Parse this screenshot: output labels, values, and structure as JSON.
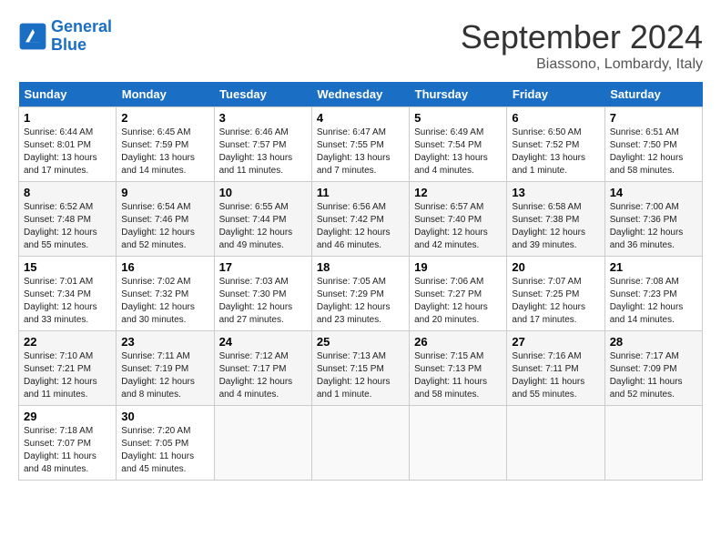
{
  "header": {
    "logo_line1": "General",
    "logo_line2": "Blue",
    "month": "September 2024",
    "location": "Biassono, Lombardy, Italy"
  },
  "weekdays": [
    "Sunday",
    "Monday",
    "Tuesday",
    "Wednesday",
    "Thursday",
    "Friday",
    "Saturday"
  ],
  "weeks": [
    [
      {
        "day": 1,
        "info": "Sunrise: 6:44 AM\nSunset: 8:01 PM\nDaylight: 13 hours\nand 17 minutes."
      },
      {
        "day": 2,
        "info": "Sunrise: 6:45 AM\nSunset: 7:59 PM\nDaylight: 13 hours\nand 14 minutes."
      },
      {
        "day": 3,
        "info": "Sunrise: 6:46 AM\nSunset: 7:57 PM\nDaylight: 13 hours\nand 11 minutes."
      },
      {
        "day": 4,
        "info": "Sunrise: 6:47 AM\nSunset: 7:55 PM\nDaylight: 13 hours\nand 7 minutes."
      },
      {
        "day": 5,
        "info": "Sunrise: 6:49 AM\nSunset: 7:54 PM\nDaylight: 13 hours\nand 4 minutes."
      },
      {
        "day": 6,
        "info": "Sunrise: 6:50 AM\nSunset: 7:52 PM\nDaylight: 13 hours\nand 1 minute."
      },
      {
        "day": 7,
        "info": "Sunrise: 6:51 AM\nSunset: 7:50 PM\nDaylight: 12 hours\nand 58 minutes."
      }
    ],
    [
      {
        "day": 8,
        "info": "Sunrise: 6:52 AM\nSunset: 7:48 PM\nDaylight: 12 hours\nand 55 minutes."
      },
      {
        "day": 9,
        "info": "Sunrise: 6:54 AM\nSunset: 7:46 PM\nDaylight: 12 hours\nand 52 minutes."
      },
      {
        "day": 10,
        "info": "Sunrise: 6:55 AM\nSunset: 7:44 PM\nDaylight: 12 hours\nand 49 minutes."
      },
      {
        "day": 11,
        "info": "Sunrise: 6:56 AM\nSunset: 7:42 PM\nDaylight: 12 hours\nand 46 minutes."
      },
      {
        "day": 12,
        "info": "Sunrise: 6:57 AM\nSunset: 7:40 PM\nDaylight: 12 hours\nand 42 minutes."
      },
      {
        "day": 13,
        "info": "Sunrise: 6:58 AM\nSunset: 7:38 PM\nDaylight: 12 hours\nand 39 minutes."
      },
      {
        "day": 14,
        "info": "Sunrise: 7:00 AM\nSunset: 7:36 PM\nDaylight: 12 hours\nand 36 minutes."
      }
    ],
    [
      {
        "day": 15,
        "info": "Sunrise: 7:01 AM\nSunset: 7:34 PM\nDaylight: 12 hours\nand 33 minutes."
      },
      {
        "day": 16,
        "info": "Sunrise: 7:02 AM\nSunset: 7:32 PM\nDaylight: 12 hours\nand 30 minutes."
      },
      {
        "day": 17,
        "info": "Sunrise: 7:03 AM\nSunset: 7:30 PM\nDaylight: 12 hours\nand 27 minutes."
      },
      {
        "day": 18,
        "info": "Sunrise: 7:05 AM\nSunset: 7:29 PM\nDaylight: 12 hours\nand 23 minutes."
      },
      {
        "day": 19,
        "info": "Sunrise: 7:06 AM\nSunset: 7:27 PM\nDaylight: 12 hours\nand 20 minutes."
      },
      {
        "day": 20,
        "info": "Sunrise: 7:07 AM\nSunset: 7:25 PM\nDaylight: 12 hours\nand 17 minutes."
      },
      {
        "day": 21,
        "info": "Sunrise: 7:08 AM\nSunset: 7:23 PM\nDaylight: 12 hours\nand 14 minutes."
      }
    ],
    [
      {
        "day": 22,
        "info": "Sunrise: 7:10 AM\nSunset: 7:21 PM\nDaylight: 12 hours\nand 11 minutes."
      },
      {
        "day": 23,
        "info": "Sunrise: 7:11 AM\nSunset: 7:19 PM\nDaylight: 12 hours\nand 8 minutes."
      },
      {
        "day": 24,
        "info": "Sunrise: 7:12 AM\nSunset: 7:17 PM\nDaylight: 12 hours\nand 4 minutes."
      },
      {
        "day": 25,
        "info": "Sunrise: 7:13 AM\nSunset: 7:15 PM\nDaylight: 12 hours\nand 1 minute."
      },
      {
        "day": 26,
        "info": "Sunrise: 7:15 AM\nSunset: 7:13 PM\nDaylight: 11 hours\nand 58 minutes."
      },
      {
        "day": 27,
        "info": "Sunrise: 7:16 AM\nSunset: 7:11 PM\nDaylight: 11 hours\nand 55 minutes."
      },
      {
        "day": 28,
        "info": "Sunrise: 7:17 AM\nSunset: 7:09 PM\nDaylight: 11 hours\nand 52 minutes."
      }
    ],
    [
      {
        "day": 29,
        "info": "Sunrise: 7:18 AM\nSunset: 7:07 PM\nDaylight: 11 hours\nand 48 minutes."
      },
      {
        "day": 30,
        "info": "Sunrise: 7:20 AM\nSunset: 7:05 PM\nDaylight: 11 hours\nand 45 minutes."
      },
      null,
      null,
      null,
      null,
      null
    ]
  ]
}
